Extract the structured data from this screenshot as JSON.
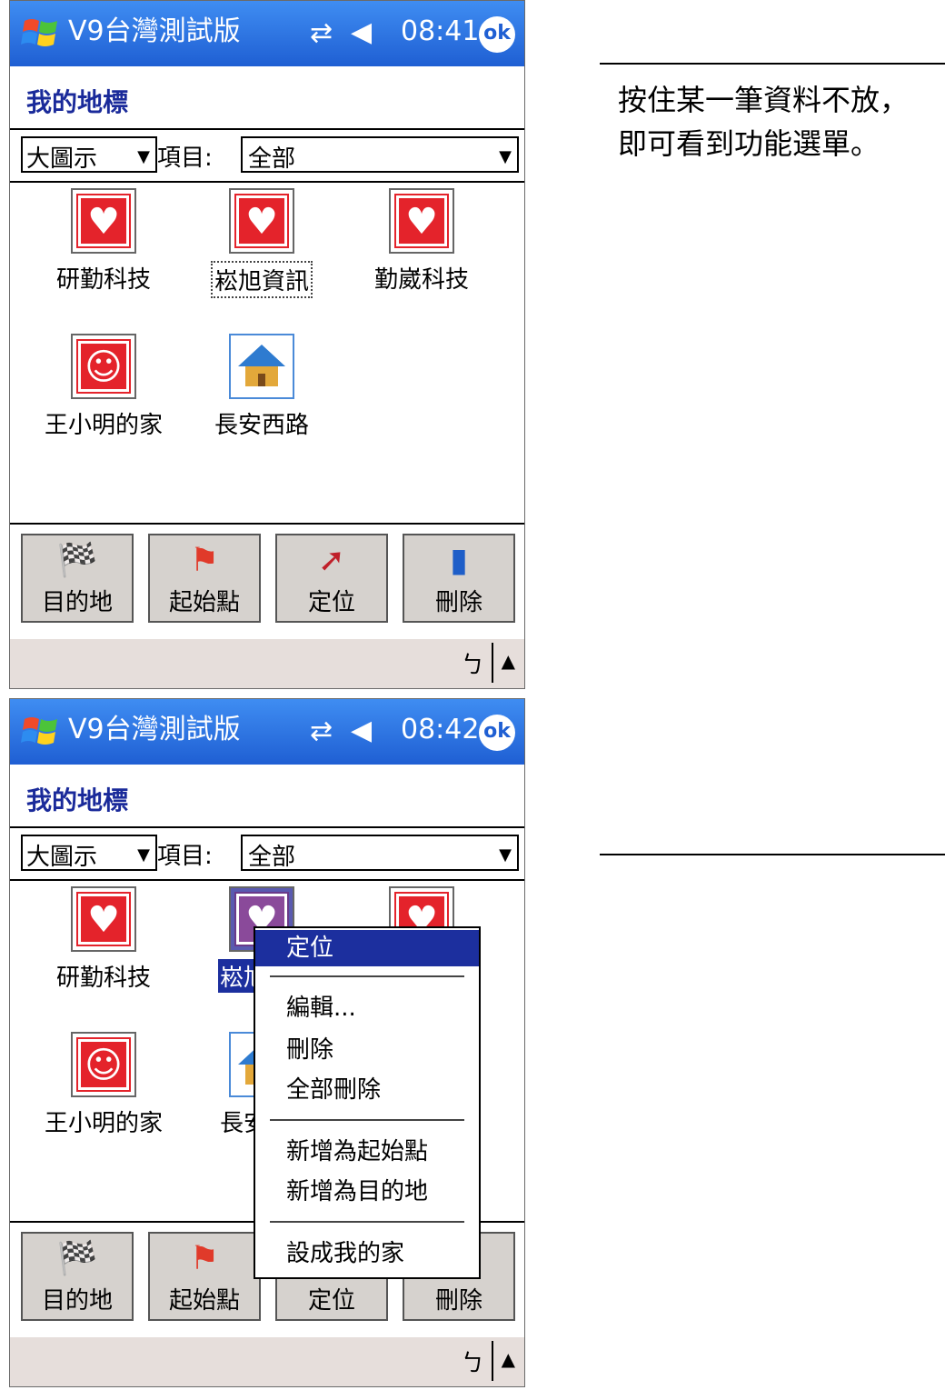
{
  "screens": [
    {
      "app_title": "V9台灣測試版",
      "clock": "08:41",
      "ok": "ok",
      "page_title": "我的地標",
      "view_select": "大圖示",
      "items_label": "項目:",
      "items_select": "全部",
      "landmarks": [
        "研勤科技",
        "崧旭資訊",
        "勤崴科技",
        "王小明的家",
        "長安西路"
      ],
      "toolbar": [
        "目的地",
        "起始點",
        "定位",
        "刪除"
      ],
      "kb_icon": "ㄅ"
    },
    {
      "app_title": "V9台灣測試版",
      "clock": "08:42",
      "ok": "ok",
      "page_title": "我的地標",
      "view_select": "大圖示",
      "items_label": "項目:",
      "items_select": "全部",
      "landmarks": [
        "研勤科技",
        "崧旭",
        "",
        "王小明的家",
        "長安"
      ],
      "toolbar": [
        "目的地",
        "起始點",
        "定位",
        "刪除"
      ],
      "kb_icon": "ㄅ",
      "context_menu": [
        "定位",
        "編輯...",
        "刪除",
        "全部刪除",
        "新增為起始點",
        "新增為目的地",
        "設成我的家"
      ]
    }
  ],
  "callout": {
    "line1": "按住某一筆資料不放，",
    "line2": "即可看到功能選單。"
  },
  "icons": {
    "heart": "heart-icon",
    "smile": "smiley-icon",
    "house": "house-icon",
    "flag": "checkered-flag-icon",
    "start_flag": "start-flag-icon",
    "locate": "locate-cursor-icon",
    "delete": "trash-can-icon"
  },
  "colors": {
    "titlebar": "#1f5fd3",
    "selection": "#1c2f9e",
    "heart_red": "#e4232b",
    "menubar": "#e6dedb"
  }
}
